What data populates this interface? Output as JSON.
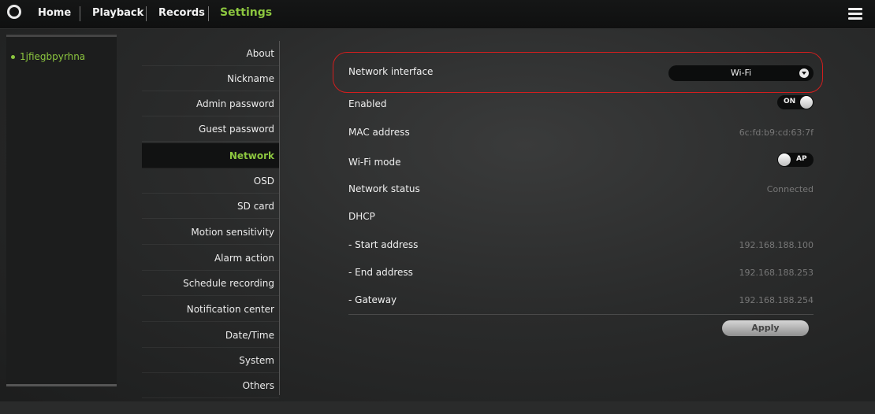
{
  "nav": {
    "items": [
      "Home",
      "Playback",
      "Records",
      "Settings"
    ],
    "active": "Settings"
  },
  "device": {
    "name": "1jfiegbpyrhna"
  },
  "menu": {
    "items": [
      "About",
      "Nickname",
      "Admin password",
      "Guest password",
      "Network",
      "OSD",
      "SD card",
      "Motion sensitivity",
      "Alarm action",
      "Schedule recording",
      "Notification center",
      "Date/Time",
      "System",
      "Others"
    ],
    "active": "Network"
  },
  "network": {
    "interface_label": "Network interface",
    "interface_value": "Wi-Fi",
    "enabled_label": "Enabled",
    "enabled_state": "ON",
    "mac_label": "MAC address",
    "mac_value": "6c:fd:b9:cd:63:7f",
    "wifi_mode_label": "Wi-Fi mode",
    "wifi_mode_state": "AP",
    "status_label": "Network status",
    "status_value": "Connected",
    "dhcp_label": "DHCP",
    "start_label": "- Start address",
    "start_value": "192.168.188.100",
    "end_label": "- End address",
    "end_value": "192.168.188.253",
    "gateway_label": "- Gateway",
    "gateway_value": "192.168.188.254",
    "apply_label": "Apply"
  },
  "colors": {
    "accent": "#8cc63f",
    "highlight": "#d21e1e"
  }
}
